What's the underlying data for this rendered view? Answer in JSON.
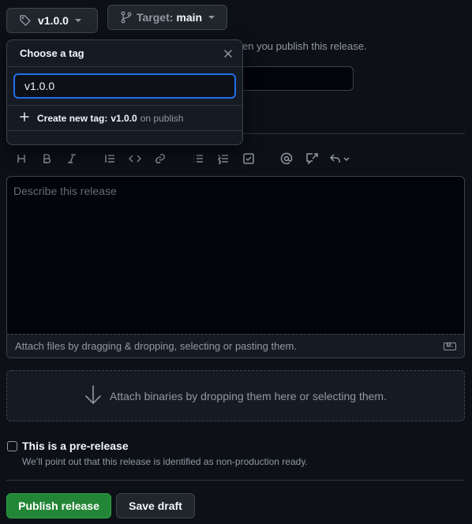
{
  "tag_button": {
    "label": "v1.0.0"
  },
  "target_button": {
    "prefix": "Target:",
    "value": "main"
  },
  "hint": "en you publish this release.",
  "tag_dropdown": {
    "title": "Choose a tag",
    "input_value": "v1.0.0",
    "create_prefix": "Create new tag:",
    "create_tag": "v1.0.0",
    "create_suffix": "on publish"
  },
  "toolbar": {
    "icons": [
      "heading-icon",
      "bold-icon",
      "italic-icon",
      "quote-icon",
      "code-icon",
      "link-icon",
      "unordered-list-icon",
      "ordered-list-icon",
      "task-list-icon",
      "mention-icon",
      "reference-icon",
      "undo-icon"
    ]
  },
  "editor": {
    "placeholder": "Describe this release",
    "footer": "Attach files by dragging & dropping, selecting or pasting them.",
    "markdown_badge": "M↓"
  },
  "dropzone": {
    "text": "Attach binaries by dropping them here or selecting them."
  },
  "prerelease": {
    "label": "This is a pre-release",
    "description": "We’ll point out that this release is identified as non-production ready."
  },
  "actions": {
    "publish": "Publish release",
    "draft": "Save draft"
  }
}
